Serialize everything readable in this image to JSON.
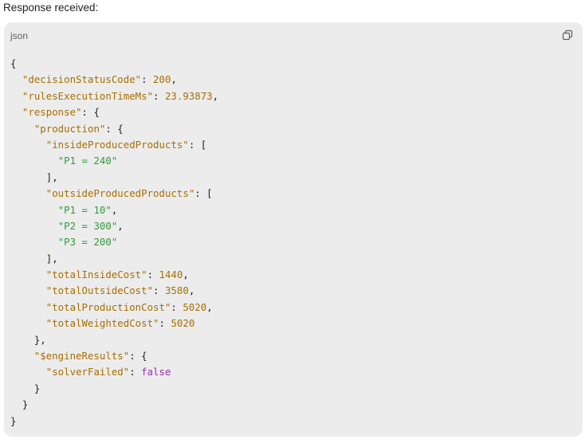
{
  "heading": "Response received:",
  "code_block": {
    "language": "json",
    "copy_icon": "copy-icon",
    "lines": [
      [
        {
          "t": "p",
          "v": "{"
        }
      ],
      [
        {
          "t": "p",
          "v": "  "
        },
        {
          "t": "k",
          "v": "\"decisionStatusCode\""
        },
        {
          "t": "p",
          "v": ": "
        },
        {
          "t": "n",
          "v": "200"
        },
        {
          "t": "p",
          "v": ","
        }
      ],
      [
        {
          "t": "p",
          "v": "  "
        },
        {
          "t": "k",
          "v": "\"rulesExecutionTimeMs\""
        },
        {
          "t": "p",
          "v": ": "
        },
        {
          "t": "n",
          "v": "23.93873"
        },
        {
          "t": "p",
          "v": ","
        }
      ],
      [
        {
          "t": "p",
          "v": "  "
        },
        {
          "t": "k",
          "v": "\"response\""
        },
        {
          "t": "p",
          "v": ": {"
        }
      ],
      [
        {
          "t": "p",
          "v": "    "
        },
        {
          "t": "k",
          "v": "\"production\""
        },
        {
          "t": "p",
          "v": ": {"
        }
      ],
      [
        {
          "t": "p",
          "v": "      "
        },
        {
          "t": "k",
          "v": "\"insideProducedProducts\""
        },
        {
          "t": "p",
          "v": ": ["
        }
      ],
      [
        {
          "t": "p",
          "v": "        "
        },
        {
          "t": "s",
          "v": "\"P1 = 240\""
        }
      ],
      [
        {
          "t": "p",
          "v": "      ],"
        }
      ],
      [
        {
          "t": "p",
          "v": "      "
        },
        {
          "t": "k",
          "v": "\"outsideProducedProducts\""
        },
        {
          "t": "p",
          "v": ": ["
        }
      ],
      [
        {
          "t": "p",
          "v": "        "
        },
        {
          "t": "s",
          "v": "\"P1 = 10\""
        },
        {
          "t": "p",
          "v": ","
        }
      ],
      [
        {
          "t": "p",
          "v": "        "
        },
        {
          "t": "s",
          "v": "\"P2 = 300\""
        },
        {
          "t": "p",
          "v": ","
        }
      ],
      [
        {
          "t": "p",
          "v": "        "
        },
        {
          "t": "s",
          "v": "\"P3 = 200\""
        }
      ],
      [
        {
          "t": "p",
          "v": "      ],"
        }
      ],
      [
        {
          "t": "p",
          "v": "      "
        },
        {
          "t": "k",
          "v": "\"totalInsideCost\""
        },
        {
          "t": "p",
          "v": ": "
        },
        {
          "t": "n",
          "v": "1440"
        },
        {
          "t": "p",
          "v": ","
        }
      ],
      [
        {
          "t": "p",
          "v": "      "
        },
        {
          "t": "k",
          "v": "\"totalOutsideCost\""
        },
        {
          "t": "p",
          "v": ": "
        },
        {
          "t": "n",
          "v": "3580"
        },
        {
          "t": "p",
          "v": ","
        }
      ],
      [
        {
          "t": "p",
          "v": "      "
        },
        {
          "t": "k",
          "v": "\"totalProductionCost\""
        },
        {
          "t": "p",
          "v": ": "
        },
        {
          "t": "n",
          "v": "5020"
        },
        {
          "t": "p",
          "v": ","
        }
      ],
      [
        {
          "t": "p",
          "v": "      "
        },
        {
          "t": "k",
          "v": "\"totalWeightedCost\""
        },
        {
          "t": "p",
          "v": ": "
        },
        {
          "t": "n",
          "v": "5020"
        }
      ],
      [
        {
          "t": "p",
          "v": "    },"
        }
      ],
      [
        {
          "t": "p",
          "v": "    "
        },
        {
          "t": "k",
          "v": "\"$engineResults\""
        },
        {
          "t": "p",
          "v": ": {"
        }
      ],
      [
        {
          "t": "p",
          "v": "      "
        },
        {
          "t": "k",
          "v": "\"solverFailed\""
        },
        {
          "t": "p",
          "v": ": "
        },
        {
          "t": "b",
          "v": "false"
        }
      ],
      [
        {
          "t": "p",
          "v": "    }"
        }
      ],
      [
        {
          "t": "p",
          "v": "  }"
        }
      ],
      [
        {
          "t": "p",
          "v": "}"
        }
      ]
    ]
  }
}
